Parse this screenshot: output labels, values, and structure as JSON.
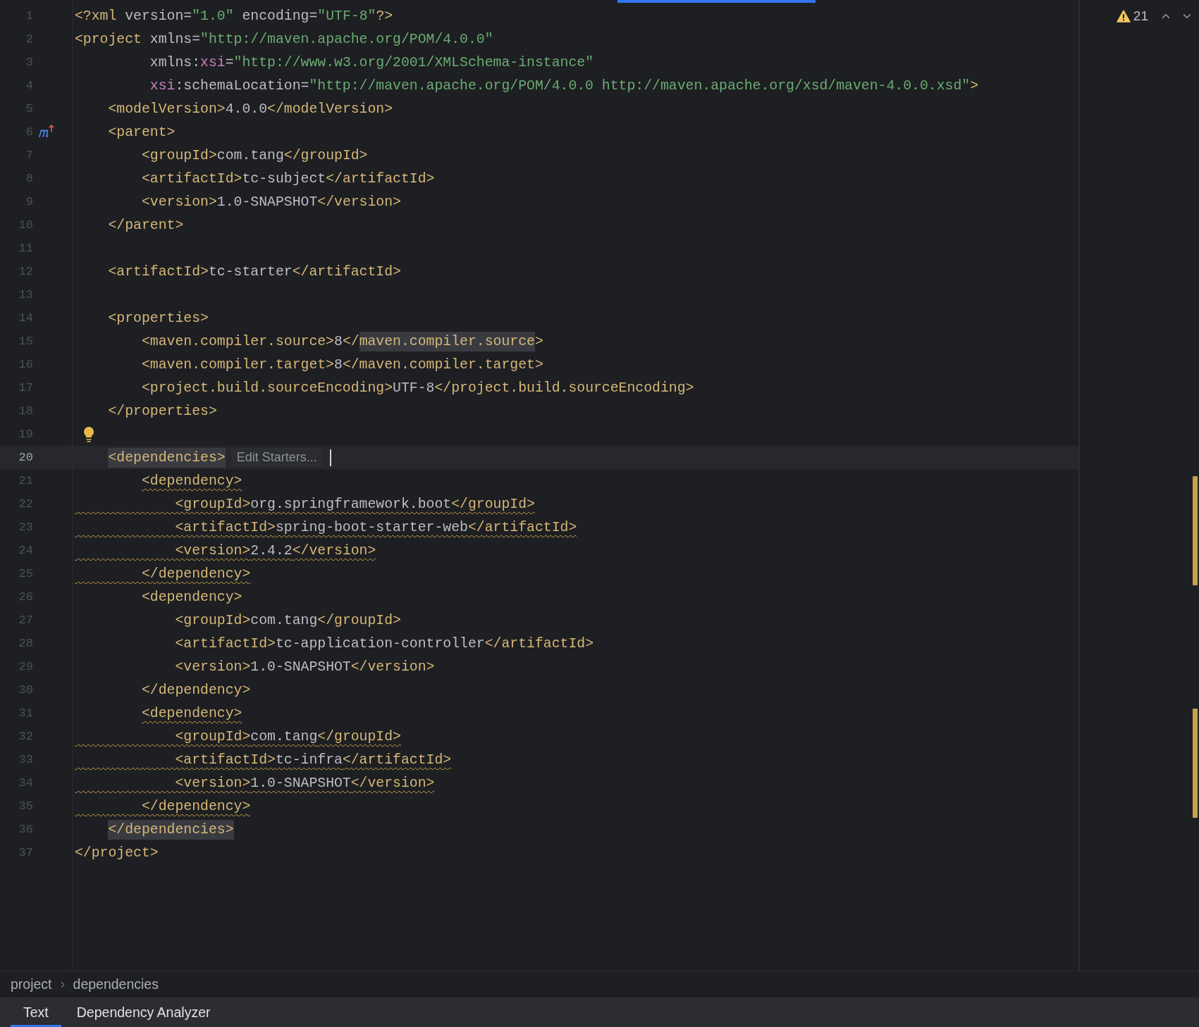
{
  "editor": {
    "lines": [
      {
        "number": "1",
        "kind": "code",
        "current": false,
        "warning": false,
        "tokens": [
          {
            "kind": "tag",
            "text": "<?xml"
          },
          {
            "kind": "attr",
            "text": " version="
          },
          {
            "kind": "str",
            "text": "\"1.0\""
          },
          {
            "kind": "attr",
            "text": " encoding="
          },
          {
            "kind": "str",
            "text": "\"UTF-8\""
          },
          {
            "kind": "tag",
            "text": "?>"
          }
        ]
      },
      {
        "number": "2",
        "kind": "code",
        "current": false,
        "warning": false,
        "tokens": [
          {
            "kind": "tag",
            "text": "<project"
          },
          {
            "kind": "attr",
            "text": " xmlns="
          },
          {
            "kind": "str",
            "text": "\"http://maven.apache.org/POM/4.0.0\""
          }
        ]
      },
      {
        "number": "3",
        "kind": "code",
        "current": false,
        "warning": false,
        "tokens": [
          {
            "kind": "attr",
            "text": "         xmlns:"
          },
          {
            "kind": "ns",
            "text": "xsi"
          },
          {
            "kind": "attr",
            "text": "="
          },
          {
            "kind": "str",
            "text": "\"http://www.w3.org/2001/XMLSchema-instance\""
          }
        ]
      },
      {
        "number": "4",
        "kind": "code",
        "current": false,
        "warning": false,
        "tokens": [
          {
            "kind": "ns",
            "text": "         xsi"
          },
          {
            "kind": "attr",
            "text": ":schemaLocation="
          },
          {
            "kind": "str",
            "text": "\"http://maven.apache.org/POM/4.0.0 http://maven.apache.org/xsd/maven-4.0.0.xsd\""
          },
          {
            "kind": "tag",
            "text": ">"
          }
        ]
      },
      {
        "number": "5",
        "kind": "code",
        "current": false,
        "warning": false,
        "tokens": [
          {
            "kind": "tag",
            "text": "    <modelVersion>"
          },
          {
            "kind": "text",
            "text": "4.0.0"
          },
          {
            "kind": "tag",
            "text": "</modelVersion>"
          }
        ]
      },
      {
        "number": "6",
        "kind": "maven",
        "current": false,
        "warning": false,
        "tokens": [
          {
            "kind": "tag",
            "text": "    <parent>"
          }
        ]
      },
      {
        "number": "7",
        "kind": "code",
        "current": false,
        "warning": false,
        "tokens": [
          {
            "kind": "tag",
            "text": "        <groupId>"
          },
          {
            "kind": "text",
            "text": "com.tang"
          },
          {
            "kind": "tag",
            "text": "</groupId>"
          }
        ]
      },
      {
        "number": "8",
        "kind": "code",
        "current": false,
        "warning": false,
        "tokens": [
          {
            "kind": "tag",
            "text": "        <artifactId>"
          },
          {
            "kind": "text",
            "text": "tc-subject"
          },
          {
            "kind": "tag",
            "text": "</artifactId>"
          }
        ]
      },
      {
        "number": "9",
        "kind": "code",
        "current": false,
        "warning": false,
        "tokens": [
          {
            "kind": "tag",
            "text": "        <version>"
          },
          {
            "kind": "text",
            "text": "1.0-SNAPSHOT"
          },
          {
            "kind": "tag",
            "text": "</version>"
          }
        ]
      },
      {
        "number": "10",
        "kind": "code",
        "current": false,
        "warning": false,
        "tokens": [
          {
            "kind": "tag",
            "text": "    </parent>"
          }
        ]
      },
      {
        "number": "11",
        "kind": "code",
        "current": false
      },
      {
        "number": "12",
        "kind": "code",
        "current": false,
        "warning": false,
        "tokens": [
          {
            "kind": "tag",
            "text": "    <artifactId>"
          },
          {
            "kind": "text",
            "text": "tc-starter"
          },
          {
            "kind": "tag",
            "text": "</artifactId>"
          }
        ]
      },
      {
        "number": "13",
        "kind": "code",
        "current": false
      },
      {
        "number": "14",
        "kind": "code",
        "current": false,
        "warning": false,
        "tokens": [
          {
            "kind": "tag",
            "text": "    <properties>"
          }
        ]
      },
      {
        "number": "15",
        "kind": "code",
        "current": false,
        "warning": false,
        "tokens": [
          {
            "kind": "tag",
            "text": "        <maven.compiler.source>"
          },
          {
            "kind": "text",
            "text": "8"
          },
          {
            "kind": "tag",
            "text": "</"
          },
          {
            "kind": "tag",
            "text": "maven.compiler.source",
            "highlighted": true
          },
          {
            "kind": "tag",
            "text": ">"
          }
        ]
      },
      {
        "number": "16",
        "kind": "code",
        "current": false,
        "warning": false,
        "tokens": [
          {
            "kind": "tag",
            "text": "        <maven.compiler.target>"
          },
          {
            "kind": "text",
            "text": "8"
          },
          {
            "kind": "tag",
            "text": "</maven.compiler.target>"
          }
        ]
      },
      {
        "number": "17",
        "kind": "code",
        "current": false,
        "warning": false,
        "tokens": [
          {
            "kind": "tag",
            "text": "        <project.build.sourceEncoding>"
          },
          {
            "kind": "text",
            "text": "UTF-8"
          },
          {
            "kind": "tag",
            "text": "</project.build.sourceEncoding>"
          }
        ]
      },
      {
        "number": "18",
        "kind": "code",
        "current": false,
        "warning": false,
        "tokens": [
          {
            "kind": "tag",
            "text": "    </properties>"
          }
        ]
      },
      {
        "number": "19",
        "kind": "bulb",
        "current": false
      },
      {
        "number": "20",
        "kind": "code",
        "current": true,
        "warning": false,
        "hint": "Edit Starters...",
        "tokens": [
          {
            "kind": "tag",
            "text": "    <dependencies>",
            "highlighted": true
          }
        ]
      },
      {
        "number": "21",
        "kind": "code",
        "current": false,
        "warning": false,
        "tokens": [
          {
            "kind": "tag",
            "text": "        <dependency>",
            "warning": true
          }
        ]
      },
      {
        "number": "22",
        "kind": "code",
        "current": false,
        "warning": true,
        "tokens": [
          {
            "kind": "tag",
            "text": "            <groupId>"
          },
          {
            "kind": "text",
            "text": "org.springframework.boot"
          },
          {
            "kind": "tag",
            "text": "</groupId>"
          }
        ]
      },
      {
        "number": "23",
        "kind": "code",
        "current": false,
        "warning": true,
        "tokens": [
          {
            "kind": "tag",
            "text": "            <artifactId>"
          },
          {
            "kind": "text",
            "text": "spring-boot-starter-web"
          },
          {
            "kind": "tag",
            "text": "</artifactId>"
          }
        ]
      },
      {
        "number": "24",
        "kind": "code",
        "current": false,
        "warning": true,
        "tokens": [
          {
            "kind": "tag",
            "text": "            <version>"
          },
          {
            "kind": "text",
            "text": "2.4.2"
          },
          {
            "kind": "tag",
            "text": "</version>"
          }
        ]
      },
      {
        "number": "25",
        "kind": "code",
        "current": false,
        "warning": true,
        "tokens": [
          {
            "kind": "tag",
            "text": "        </dependency>"
          }
        ]
      },
      {
        "number": "26",
        "kind": "code",
        "current": false,
        "warning": false,
        "tokens": [
          {
            "kind": "tag",
            "text": "        <dependency>"
          }
        ]
      },
      {
        "number": "27",
        "kind": "code",
        "current": false,
        "warning": false,
        "tokens": [
          {
            "kind": "tag",
            "text": "            <groupId>"
          },
          {
            "kind": "text",
            "text": "com.tang"
          },
          {
            "kind": "tag",
            "text": "</groupId>"
          }
        ]
      },
      {
        "number": "28",
        "kind": "code",
        "current": false,
        "warning": false,
        "tokens": [
          {
            "kind": "tag",
            "text": "            <artifactId>"
          },
          {
            "kind": "text",
            "text": "tc-application-controller"
          },
          {
            "kind": "tag",
            "text": "</artifactId>"
          }
        ]
      },
      {
        "number": "29",
        "kind": "code",
        "current": false,
        "warning": false,
        "tokens": [
          {
            "kind": "tag",
            "text": "            <version>"
          },
          {
            "kind": "text",
            "text": "1.0-SNAPSHOT"
          },
          {
            "kind": "tag",
            "text": "</version>"
          }
        ]
      },
      {
        "number": "30",
        "kind": "code",
        "current": false,
        "warning": false,
        "tokens": [
          {
            "kind": "tag",
            "text": "        </dependency>"
          }
        ]
      },
      {
        "number": "31",
        "kind": "code",
        "current": false,
        "warning": false,
        "tokens": [
          {
            "kind": "tag",
            "text": "        <dependency>",
            "warning": true
          }
        ]
      },
      {
        "number": "32",
        "kind": "code",
        "current": false,
        "warning": true,
        "tokens": [
          {
            "kind": "tag",
            "text": "            <groupId>"
          },
          {
            "kind": "text",
            "text": "com.tang"
          },
          {
            "kind": "tag",
            "text": "</groupId>"
          }
        ]
      },
      {
        "number": "33",
        "kind": "code",
        "current": false,
        "warning": true,
        "tokens": [
          {
            "kind": "tag",
            "text": "            <artifactId>"
          },
          {
            "kind": "text",
            "text": "tc-infra"
          },
          {
            "kind": "tag",
            "text": "</artifactId>"
          }
        ]
      },
      {
        "number": "34",
        "kind": "code",
        "current": false,
        "warning": true,
        "tokens": [
          {
            "kind": "tag",
            "text": "            <version>"
          },
          {
            "kind": "text",
            "text": "1.0-SNAPSHOT"
          },
          {
            "kind": "tag",
            "text": "</version>"
          }
        ]
      },
      {
        "number": "35",
        "kind": "code",
        "current": false,
        "warning": true,
        "tokens": [
          {
            "kind": "tag",
            "text": "        </dependency>"
          }
        ]
      },
      {
        "number": "36",
        "kind": "code",
        "current": false,
        "warning": false,
        "tokens": [
          {
            "kind": "tag",
            "text": "    </dependencies>",
            "highlighted": true
          }
        ]
      },
      {
        "number": "37",
        "kind": "code",
        "current": false,
        "warning": false,
        "tokens": [
          {
            "kind": "tag",
            "text": "</project>"
          }
        ]
      }
    ],
    "inspections": {
      "warnings": "21"
    }
  },
  "breadcrumbs": [
    "project",
    "dependencies"
  ],
  "tabs": [
    {
      "label": "Text",
      "selected": true
    },
    {
      "label": "Dependency Analyzer",
      "selected": false
    }
  ]
}
